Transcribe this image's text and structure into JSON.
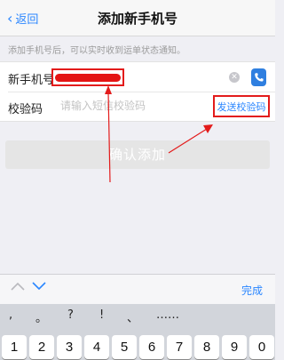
{
  "nav": {
    "back_label": "返回",
    "title": "添加新手机号"
  },
  "notice": "添加手机号后，可以实时收到运单状态通知。",
  "form": {
    "phone_label": "新手机号",
    "code_label": "校验码",
    "code_placeholder": "请输入短信校验码",
    "send_code_label": "发送校验码"
  },
  "confirm_label": "确认添加",
  "keyboard": {
    "done_label": "完成",
    "punctuation": [
      ",",
      "。",
      "?",
      "!",
      "、",
      "……"
    ],
    "numbers": [
      "1",
      "2",
      "3",
      "4",
      "5",
      "6",
      "7",
      "8",
      "9",
      "0"
    ]
  },
  "colors": {
    "accent": "#2a86ff",
    "annotation": "#e31b1b"
  }
}
